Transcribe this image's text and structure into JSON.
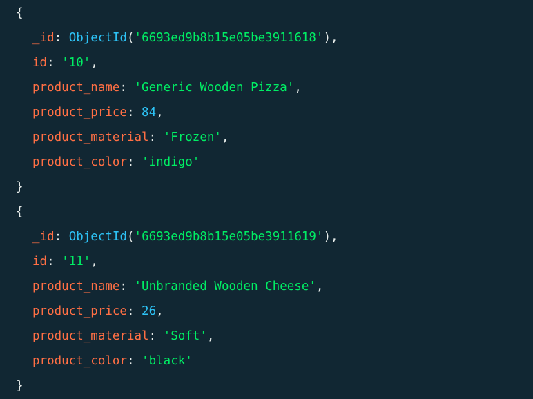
{
  "colors": {
    "background": "#112733",
    "key": "#ff6f44",
    "string": "#00ed64",
    "number": "#2dc2f5",
    "punctuation": "#e8edeb"
  },
  "documents": [
    {
      "open_brace": "{",
      "close_brace": "}",
      "fields": {
        "_id": {
          "key": "_id",
          "func": "ObjectId",
          "value": "'6693ed9b8b15e05be3911618'"
        },
        "id": {
          "key": "id",
          "value": "'10'"
        },
        "product_name": {
          "key": "product_name",
          "value": "'Generic Wooden Pizza'"
        },
        "product_price": {
          "key": "product_price",
          "value": "84"
        },
        "product_material": {
          "key": "product_material",
          "value": "'Frozen'"
        },
        "product_color": {
          "key": "product_color",
          "value": "'indigo'"
        }
      }
    },
    {
      "open_brace": "{",
      "close_brace": "}",
      "fields": {
        "_id": {
          "key": "_id",
          "func": "ObjectId",
          "value": "'6693ed9b8b15e05be3911619'"
        },
        "id": {
          "key": "id",
          "value": "'11'"
        },
        "product_name": {
          "key": "product_name",
          "value": "'Unbranded Wooden Cheese'"
        },
        "product_price": {
          "key": "product_price",
          "value": "26"
        },
        "product_material": {
          "key": "product_material",
          "value": "'Soft'"
        },
        "product_color": {
          "key": "product_color",
          "value": "'black'"
        }
      }
    }
  ]
}
